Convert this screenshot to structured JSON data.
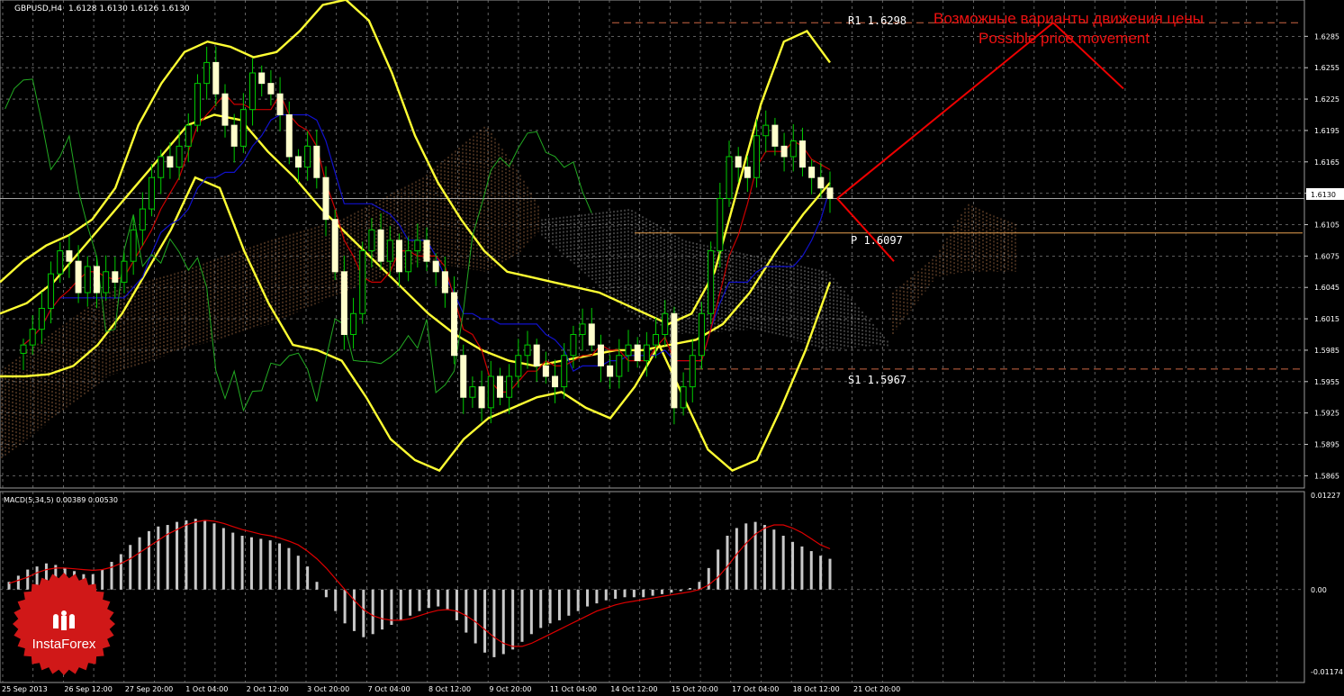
{
  "header": {
    "symbol": "GBPUSD,H4",
    "ohlc": "1.6128 1.6130 1.6126 1.6130"
  },
  "annotations": {
    "ru": "Возможные варианты движения цены",
    "en": "Possible price movement",
    "r1": "R1  1.6298",
    "pivot": "P  1.6097",
    "s1": "S1  1.5967",
    "current_price": "1.6130"
  },
  "macd": {
    "label": "MACD(5,34,5) 0.00389 0.00530"
  },
  "logo": {
    "text": "InstaForex"
  },
  "colors": {
    "candle": "#ffffcc",
    "bollinger": "#ffff33",
    "tenkan": "#cc0000",
    "kijun": "#1111cc",
    "chikou": "#22aa22",
    "cloud_bull": "#cc8855",
    "cloud_bear": "#bbbbbb",
    "levels": "#cc6644",
    "forecast": "#ee0000",
    "macd_hist": "#c8c8c8",
    "macd_signal": "#dd0000",
    "grid": "#7a7a7a",
    "logo_red": "#d01818"
  },
  "chart_data": [
    {
      "type": "candlestick",
      "symbol": "GBPUSD",
      "timeframe": "H4",
      "y_ticks": [
        "1.6285",
        "1.6255",
        "1.6225",
        "1.6195",
        "1.6165",
        "1.6135",
        "1.6105",
        "1.6075",
        "1.6045",
        "1.6015",
        "1.5985",
        "1.5955",
        "1.5925",
        "1.5895",
        "1.5865"
      ],
      "ylim": [
        1.5855,
        1.6318
      ],
      "x_ticks": [
        "25 Sep 2013",
        "26 Sep 12:00",
        "27 Sep 20:00",
        "1 Oct 04:00",
        "2 Oct 12:00",
        "3 Oct 20:00",
        "7 Oct 04:00",
        "8 Oct 12:00",
        "9 Oct 20:00",
        "11 Oct 04:00",
        "14 Oct 12:00",
        "15 Oct 20:00",
        "17 Oct 04:00",
        "18 Oct 12:00",
        "21 Oct 20:00"
      ],
      "close_path": [
        1.599,
        1.6005,
        1.6025,
        1.6058,
        1.608,
        1.607,
        1.604,
        1.6065,
        1.604,
        1.606,
        1.605,
        1.607,
        1.61,
        1.612,
        1.615,
        1.617,
        1.616,
        1.618,
        1.62,
        1.624,
        1.626,
        1.623,
        1.62,
        1.618,
        1.6215,
        1.625,
        1.624,
        1.623,
        1.621,
        1.617,
        1.616,
        1.618,
        1.615,
        1.611,
        1.606,
        1.6,
        1.602,
        1.608,
        1.61,
        1.607,
        1.609,
        1.606,
        1.608,
        1.609,
        1.607,
        1.606,
        1.604,
        1.598,
        1.594,
        1.595,
        1.593,
        1.596,
        1.594,
        1.596,
        1.598,
        1.599,
        1.597,
        1.596,
        1.595,
        1.598,
        1.6,
        1.601,
        1.599,
        1.597,
        1.596,
        1.598,
        1.599,
        1.5975,
        1.599,
        1.6,
        1.602,
        1.593,
        1.595,
        1.598,
        1.602,
        1.608,
        1.613,
        1.617,
        1.616,
        1.615,
        1.619,
        1.62,
        1.618,
        1.617,
        1.6185,
        1.616,
        1.615,
        1.614,
        1.613
      ],
      "bollinger_upper": [
        1.605,
        1.607,
        1.6085,
        1.6095,
        1.611,
        1.614,
        1.62,
        1.624,
        1.627,
        1.628,
        1.6275,
        1.6265,
        1.627,
        1.629,
        1.6315,
        1.632,
        1.63,
        1.625,
        1.619,
        1.6145,
        1.611,
        1.608,
        1.606,
        1.6055,
        1.605,
        1.6045,
        1.604,
        1.603,
        1.602,
        1.601,
        1.602,
        1.606,
        1.614,
        1.622,
        1.628,
        1.629,
        1.626
      ],
      "bollinger_middle": [
        1.602,
        1.603,
        1.605,
        1.608,
        1.611,
        1.614,
        1.617,
        1.62,
        1.621,
        1.6205,
        1.6175,
        1.615,
        1.612,
        1.6095,
        1.607,
        1.6045,
        1.602,
        1.6,
        1.5985,
        1.5975,
        1.597,
        1.5975,
        1.598,
        1.5985,
        1.5985,
        1.599,
        1.5995,
        1.601,
        1.604,
        1.608,
        1.6115,
        1.6145
      ],
      "bollinger_lower": [
        1.596,
        1.596,
        1.5962,
        1.597,
        1.599,
        1.602,
        1.606,
        1.61,
        1.615,
        1.614,
        1.608,
        1.603,
        1.599,
        1.5985,
        1.5975,
        1.594,
        1.59,
        1.588,
        1.587,
        1.59,
        1.592,
        1.593,
        1.594,
        1.5945,
        1.593,
        1.592,
        1.595,
        1.599,
        1.594,
        1.589,
        1.587,
        1.588,
        1.593,
        1.5985,
        1.605
      ],
      "levels": [
        {
          "name": "R1",
          "value": 1.6298
        },
        {
          "name": "P",
          "value": 1.6097
        },
        {
          "name": "S1",
          "value": 1.5967
        }
      ],
      "current_price": 1.613,
      "forecast_up": [
        1.613,
        1.6298
      ],
      "forecast_down": [
        1.613,
        1.607
      ]
    },
    {
      "type": "bar",
      "title": "MACD(5,34,5) 0.00389 0.00530",
      "y_ticks": [
        "0.01227",
        "0.00",
        "-0.01174"
      ],
      "ylim": [
        -0.01174,
        0.01227
      ],
      "histogram": [
        0.001,
        0.0018,
        0.0026,
        0.003,
        0.0034,
        0.0032,
        0.0028,
        0.0024,
        0.002,
        0.002,
        0.0026,
        0.0036,
        0.0046,
        0.0058,
        0.0068,
        0.0076,
        0.0082,
        0.0084,
        0.0088,
        0.009,
        0.0092,
        0.009,
        0.0086,
        0.008,
        0.0074,
        0.007,
        0.0068,
        0.0066,
        0.0064,
        0.006,
        0.0054,
        0.0044,
        0.003,
        0.001,
        -0.001,
        -0.0028,
        -0.0044,
        -0.0054,
        -0.0062,
        -0.0058,
        -0.0052,
        -0.0046,
        -0.004,
        -0.0034,
        -0.0028,
        -0.0024,
        -0.0022,
        -0.0026,
        -0.004,
        -0.0056,
        -0.007,
        -0.0082,
        -0.0088,
        -0.0084,
        -0.0078,
        -0.0068,
        -0.0058,
        -0.005,
        -0.0044,
        -0.004,
        -0.0034,
        -0.0028,
        -0.0022,
        -0.0018,
        -0.0014,
        -0.0012,
        -0.001,
        -0.001,
        -0.001,
        -0.0008,
        -0.0006,
        -0.0004,
        -0.0002,
        0.0002,
        0.001,
        0.0028,
        0.0052,
        0.007,
        0.008,
        0.0086,
        0.0088,
        0.0084,
        0.0078,
        0.007,
        0.0062,
        0.0056,
        0.005,
        0.0044,
        0.004
      ],
      "signal": [
        0.0008,
        0.0012,
        0.0016,
        0.0022,
        0.0026,
        0.0028,
        0.0028,
        0.0027,
        0.0026,
        0.0025,
        0.0026,
        0.0029,
        0.0034,
        0.004,
        0.0048,
        0.0056,
        0.0064,
        0.0072,
        0.0078,
        0.0084,
        0.0088,
        0.009,
        0.0089,
        0.0086,
        0.0082,
        0.0078,
        0.0075,
        0.0072,
        0.007,
        0.0067,
        0.0063,
        0.0058,
        0.005,
        0.004,
        0.0028,
        0.0014,
        0.0,
        -0.0014,
        -0.0026,
        -0.0034,
        -0.0038,
        -0.004,
        -0.004,
        -0.0038,
        -0.0034,
        -0.003,
        -0.0027,
        -0.0026,
        -0.0028,
        -0.0034,
        -0.0042,
        -0.0052,
        -0.0062,
        -0.007,
        -0.0074,
        -0.0074,
        -0.007,
        -0.0064,
        -0.0058,
        -0.0052,
        -0.0046,
        -0.004,
        -0.0034,
        -0.0028,
        -0.0024,
        -0.002,
        -0.0017,
        -0.0015,
        -0.0013,
        -0.0011,
        -0.0009,
        -0.0007,
        -0.0005,
        -0.0003,
        0.0,
        0.0006,
        0.0016,
        0.003,
        0.0046,
        0.006,
        0.0072,
        0.008,
        0.0084,
        0.0084,
        0.008,
        0.0074,
        0.0066,
        0.0058,
        0.0053
      ]
    }
  ]
}
